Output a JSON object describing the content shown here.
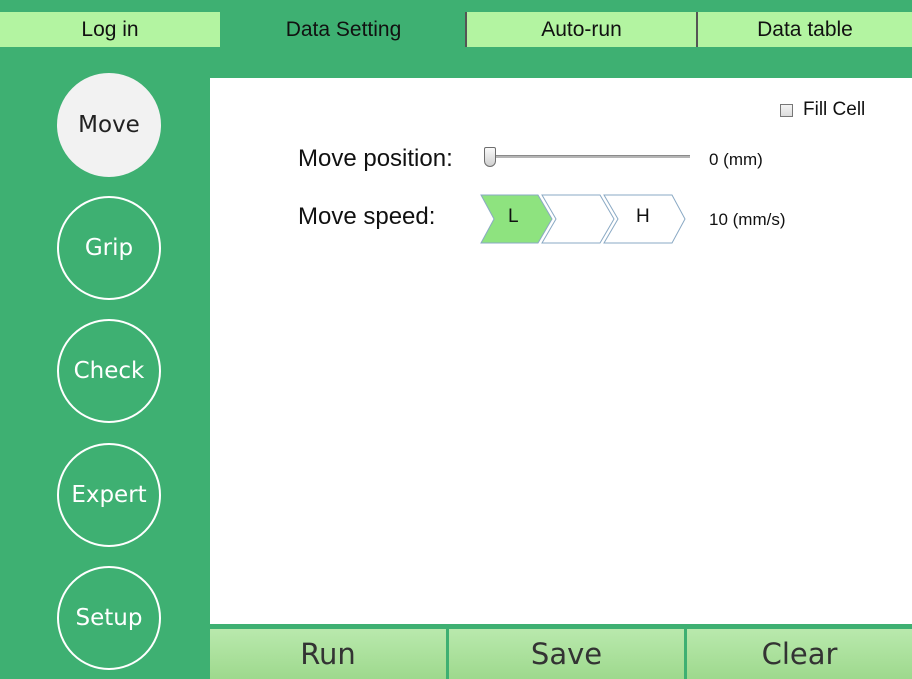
{
  "tabs": [
    {
      "label": "Log in",
      "active": false
    },
    {
      "label": "Data Setting",
      "active": true
    },
    {
      "label": "Auto-run",
      "active": false
    },
    {
      "label": "Data table",
      "active": false
    }
  ],
  "sidebar": {
    "items": [
      {
        "label": "Move",
        "selected": true
      },
      {
        "label": "Grip",
        "selected": false
      },
      {
        "label": "Check",
        "selected": false
      },
      {
        "label": "Expert",
        "selected": false
      },
      {
        "label": "Setup",
        "selected": false
      }
    ]
  },
  "fill_cell": {
    "label": "Fill Cell",
    "checked": false
  },
  "move_position": {
    "label": "Move position:",
    "value_text": "0 (mm)",
    "level": 0
  },
  "move_speed": {
    "label": "Move speed:",
    "low_label": "L",
    "high_label": "H",
    "value_text": "10 (mm/s)",
    "selected_step": 1,
    "steps": 3
  },
  "bottom": {
    "run_label": "Run",
    "save_label": "Save",
    "clear_label": "Clear"
  },
  "colors": {
    "frame_green": "#3eb072",
    "light_green": "#b3f4a1",
    "button_green": "#a8df98",
    "speed_selected": "#8ee37f"
  }
}
